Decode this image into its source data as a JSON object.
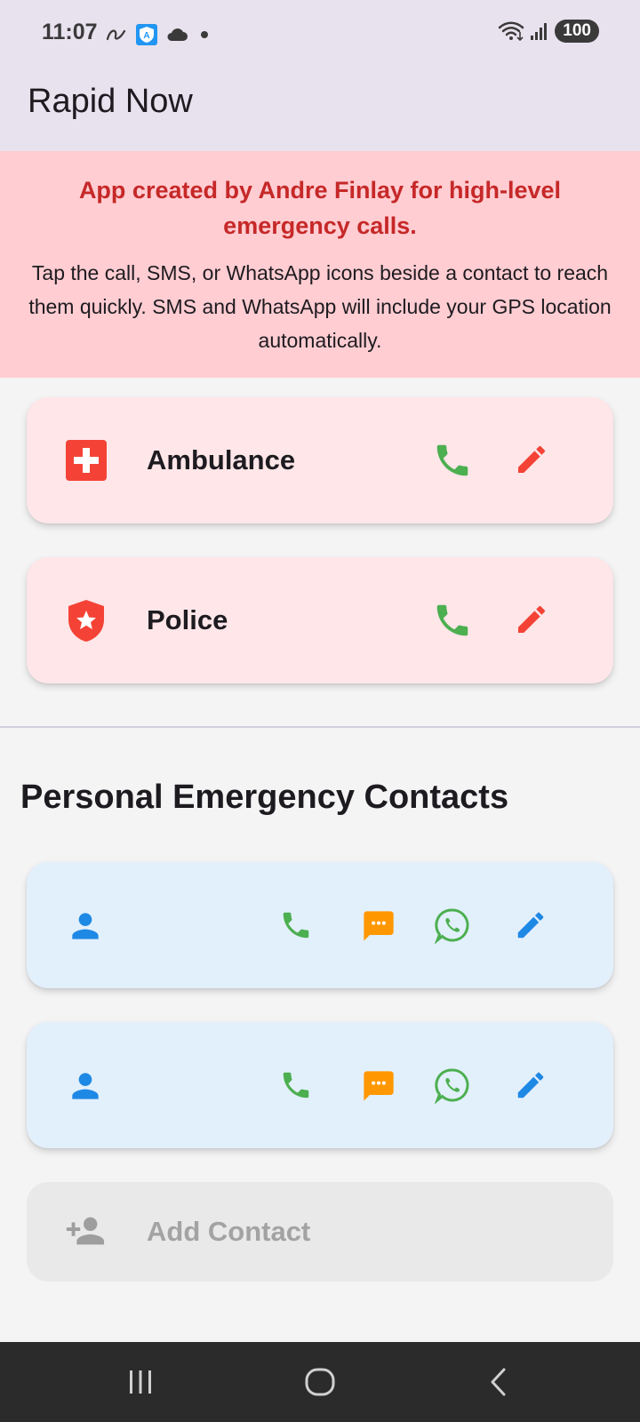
{
  "status_bar": {
    "time": "11:07",
    "battery": "100",
    "left_icons": [
      "a-icon",
      "shield-a-icon",
      "cloud-icon",
      "dot-icon"
    ],
    "right_icons": [
      "wifi-icon",
      "signal-icon"
    ]
  },
  "app_bar": {
    "title": "Rapid Now"
  },
  "banner": {
    "title": "App created by Andre Finlay for high-level emergency calls.",
    "body": "Tap the call, SMS, or WhatsApp icons beside a contact to reach them quickly. SMS and WhatsApp will include your GPS location automatically."
  },
  "emergency_contacts": [
    {
      "label": "Ambulance",
      "icon": "medical-cross-icon",
      "actions": [
        "phone-icon",
        "edit-icon"
      ]
    },
    {
      "label": "Police",
      "icon": "police-shield-icon",
      "actions": [
        "phone-icon",
        "edit-icon"
      ]
    }
  ],
  "section": {
    "title": "Personal Emergency Contacts"
  },
  "personal_contacts": [
    {
      "label": "",
      "icon": "person-icon",
      "actions": [
        "phone-icon",
        "sms-icon",
        "whatsapp-icon",
        "edit-icon"
      ]
    },
    {
      "label": "",
      "icon": "person-icon",
      "actions": [
        "phone-icon",
        "sms-icon",
        "whatsapp-icon",
        "edit-icon"
      ]
    }
  ],
  "add_contact": {
    "label": "Add Contact",
    "icon": "add-person-icon"
  },
  "nav_bar": {
    "buttons": [
      "recent-apps-icon",
      "home-icon",
      "back-icon"
    ]
  },
  "colors": {
    "app_bar_bg": "#e8e1ee",
    "banner_bg": "#ffcdd2",
    "banner_title": "#c62828",
    "emergency_card_bg": "#ffe6e8",
    "personal_card_bg": "#e2f0fc",
    "red_icon": "#f44336",
    "green_call": "#4caf50",
    "orange_sms": "#ff9800",
    "blue_icon": "#1e88e5",
    "grey_add": "#a3a3a3"
  }
}
